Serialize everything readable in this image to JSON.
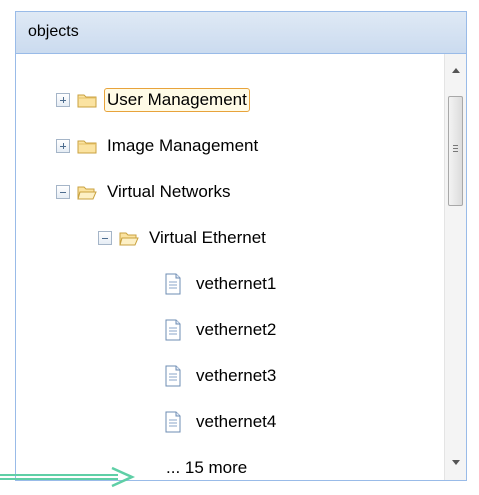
{
  "panel": {
    "title": "objects"
  },
  "tree": {
    "nodes": [
      {
        "label": "User Management",
        "expanded": false,
        "selected": true,
        "icon": "folder-closed-icon"
      },
      {
        "label": "Image Management",
        "expanded": false,
        "selected": false,
        "icon": "folder-closed-icon"
      },
      {
        "label": "Virtual Networks",
        "expanded": true,
        "selected": false,
        "icon": "folder-open-icon"
      },
      {
        "label": "Virtual Ethernet",
        "expanded": true,
        "selected": false,
        "icon": "folder-open-icon"
      },
      {
        "label": "vethernet1",
        "icon": "document-icon"
      },
      {
        "label": "vethernet2",
        "icon": "document-icon"
      },
      {
        "label": "vethernet3",
        "icon": "document-icon"
      },
      {
        "label": "vethernet4",
        "icon": "document-icon"
      }
    ],
    "more_label": "... 15 more"
  },
  "colors": {
    "border": "#99bbe8",
    "folder": "#f5cc5a",
    "selection": "#e8a33b",
    "arrow": "#5fcfa6"
  }
}
